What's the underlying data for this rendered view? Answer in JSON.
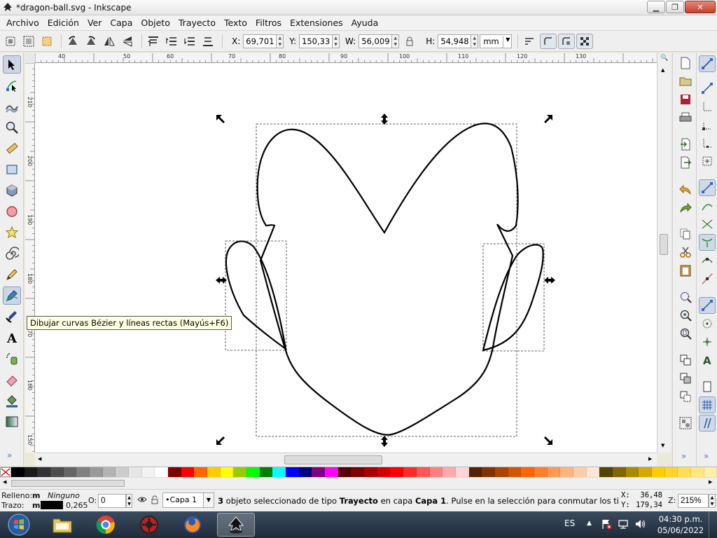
{
  "window": {
    "title": "*dragon-ball.svg - Inkscape"
  },
  "menubar": {
    "items": [
      "Archivo",
      "Edición",
      "Ver",
      "Capa",
      "Objeto",
      "Trayecto",
      "Texto",
      "Filtros",
      "Extensiones",
      "Ayuda"
    ]
  },
  "controls": {
    "x_label": "X:",
    "x_value": "69,701",
    "y_label": "Y:",
    "y_value": "150,334",
    "w_label": "W:",
    "w_value": "56,009",
    "h_label": "H:",
    "h_value": "54,948",
    "unit": "mm"
  },
  "rulers": {
    "top_labels": [
      "40",
      "50",
      "60",
      "70",
      "80",
      "90",
      "100",
      "110",
      "120",
      "130"
    ],
    "left_labels": [
      "210",
      "200",
      "190",
      "180",
      "170",
      "160",
      "150"
    ]
  },
  "tooltip": {
    "text": "Dibujar curvas Bézier y líneas rectas (Mayús+F6)"
  },
  "palette": {
    "colors": [
      "#000000",
      "#1a1a1a",
      "#333333",
      "#4d4d4d",
      "#666666",
      "#808080",
      "#999999",
      "#b3b3b3",
      "#cccccc",
      "#e6e6e6",
      "#f2f2f2",
      "#ffffff",
      "#800000",
      "#ff0000",
      "#ff6600",
      "#ffcc00",
      "#ffff00",
      "#99cc00",
      "#00ff00",
      "#008000",
      "#00ffff",
      "#0000ff",
      "#000080",
      "#800080",
      "#ff00ff",
      "#550000",
      "#800000",
      "#aa0000",
      "#d40000",
      "#ff0000",
      "#ff2a2a",
      "#ff5555",
      "#ff8080",
      "#ffaaaa",
      "#ffd5d5",
      "#552200",
      "#803300",
      "#aa4400",
      "#d45500",
      "#ff6600",
      "#ff7f2a",
      "#ff9955",
      "#ffb380",
      "#ffccaa",
      "#ffe6d5",
      "#554400",
      "#806600",
      "#aa8800",
      "#d4aa00",
      "#ffcc00",
      "#ffd42a",
      "#ffdd55",
      "#ffe680",
      "#ffeeaa"
    ]
  },
  "status": {
    "fill_label": "Relleno:",
    "fill_flag": "m",
    "fill_value": "Ninguno",
    "stroke_label": "Trazo:",
    "stroke_flag": "m",
    "stroke_width": "0,265",
    "opacity_label": "O:",
    "opacity_value": "0",
    "layer": "•Capa 1",
    "message_count": "3",
    "message_part1": " objeto seleccionado de tipo ",
    "message_type": "Trayecto",
    "message_part2": " en capa ",
    "message_layer": "Capa 1",
    "message_part3": ". Pulse en la selección para conmutar los tiradores d...",
    "x_coord_label": "X:",
    "x_coord": "36,48",
    "y_coord_label": "Y:",
    "y_coord": "179,34",
    "zoom_label": "Z:",
    "zoom": "215%"
  },
  "taskbar": {
    "language": "ES",
    "time": "04:30 p.m.",
    "date": "05/06/2022"
  }
}
